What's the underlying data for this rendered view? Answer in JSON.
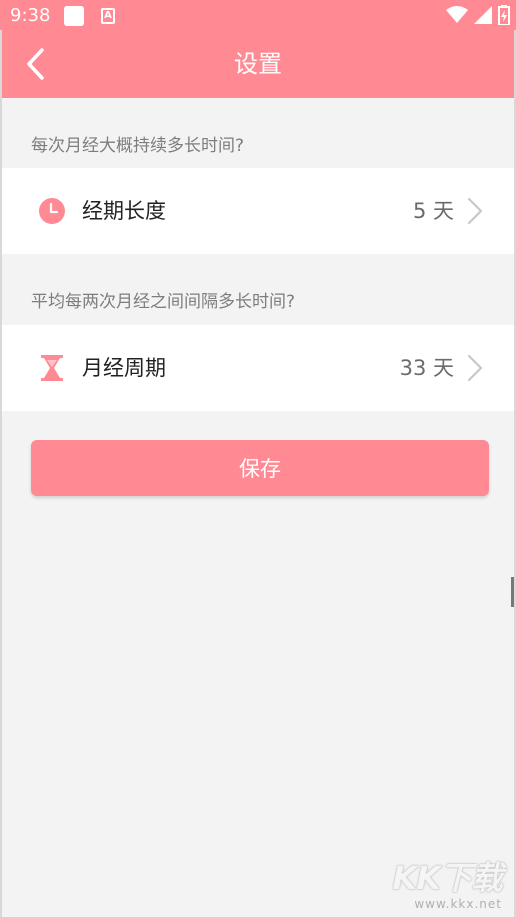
{
  "status_bar": {
    "time": "9:38",
    "app_badge": "A"
  },
  "nav": {
    "title": "设置"
  },
  "sections": [
    {
      "question": "每次月经大概持续多长时间?",
      "row": {
        "label": "经期长度",
        "value": "5 天",
        "icon": "clock-icon"
      }
    },
    {
      "question": "平均每两次月经之间间隔多长时间?",
      "row": {
        "label": "月经周期",
        "value": "33 天",
        "icon": "hourglass-icon"
      }
    }
  ],
  "actions": {
    "save_label": "保存"
  },
  "watermark": {
    "logo": "KK下载",
    "url": "www.kkx.net"
  },
  "colors": {
    "accent": "#ff8a94",
    "background": "#f3f3f3",
    "card": "#ffffff"
  }
}
